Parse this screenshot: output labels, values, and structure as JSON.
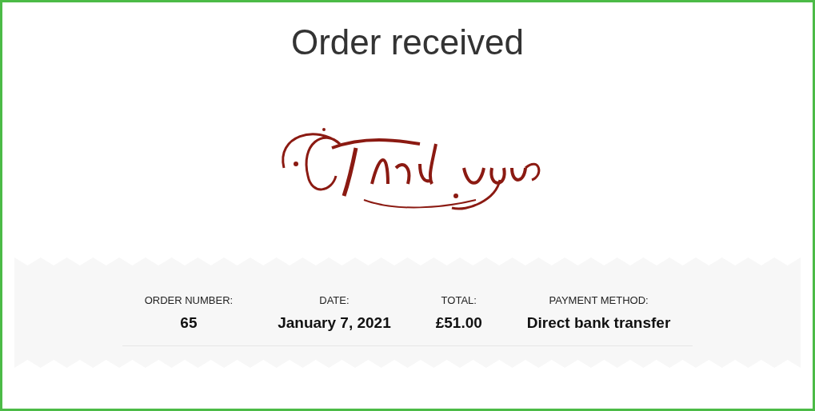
{
  "title": "Order received",
  "order_details": [
    {
      "label": "ORDER NUMBER:",
      "value": "65"
    },
    {
      "label": "DATE:",
      "value": "January 7, 2021"
    },
    {
      "label": "TOTAL:",
      "value": "£51.00"
    },
    {
      "label": "PAYMENT METHOD:",
      "value": "Direct bank transfer"
    }
  ]
}
